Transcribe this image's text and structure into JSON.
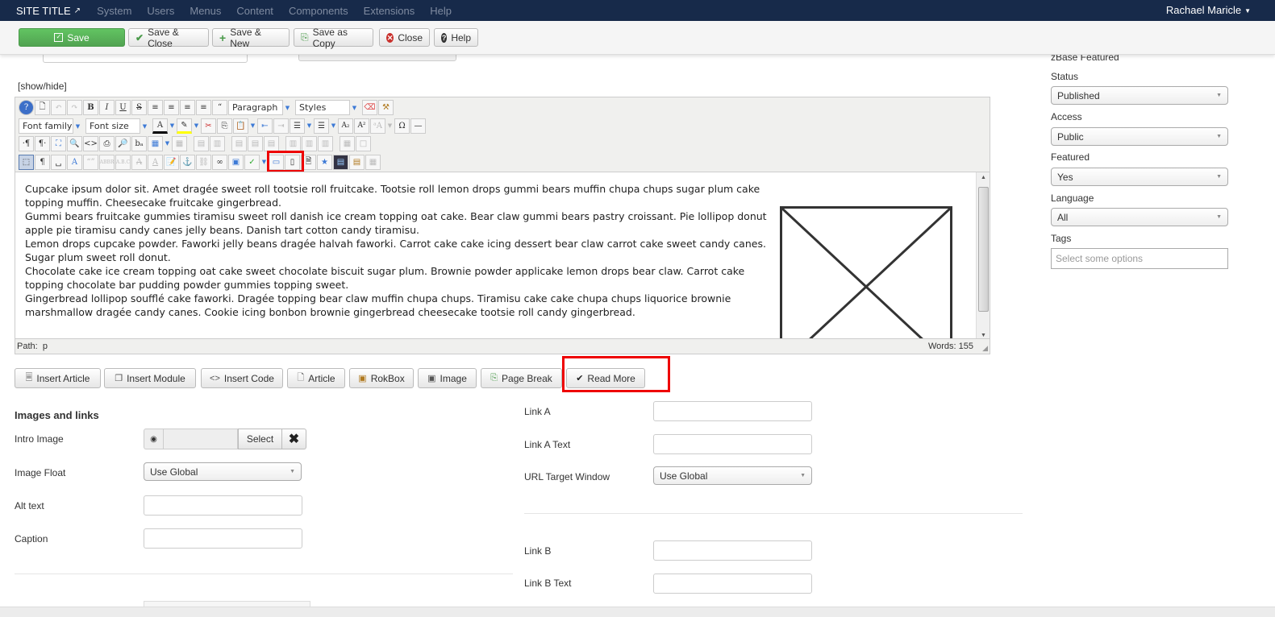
{
  "navbar": {
    "site_title": "SITE TITLE",
    "site_title_icon": "external-link-icon",
    "menu": [
      "System",
      "Users",
      "Menus",
      "Content",
      "Components",
      "Extensions",
      "Help"
    ],
    "user": "Rachael Maricle"
  },
  "toolbar": {
    "save": "Save",
    "save_close": "Save & Close",
    "save_new": "Save & New",
    "save_copy": "Save as Copy",
    "close": "Close",
    "help": "Help"
  },
  "editor": {
    "show_hide": "[show/hide]",
    "format_select": "Paragraph",
    "styles_select": "Styles",
    "font_family_select": "Font family",
    "font_size_select": "Font size",
    "paragraphs": [
      "Cupcake ipsum dolor sit. Amet dragée sweet roll tootsie roll fruitcake. Tootsie roll lemon drops gummi bears muffin chupa chups sugar plum cake topping muffin. Cheesecake fruitcake gingerbread.",
      "Gummi bears fruitcake gummies tiramisu sweet roll danish ice cream topping oat cake. Bear claw gummi bears pastry croissant. Pie lollipop donut apple pie tiramisu candy canes jelly beans. Danish tart cotton candy tiramisu.",
      "Lemon drops cupcake powder. Faworki jelly beans dragée halvah faworki. Carrot cake cake icing dessert bear claw carrot cake sweet candy canes. Sugar plum sweet roll donut.",
      "Chocolate cake ice cream topping oat cake sweet chocolate biscuit sugar plum. Brownie powder applicake lemon drops bear claw. Carrot cake topping chocolate bar pudding powder gummies topping sweet.",
      "Gingerbread lollipop soufflé cake faworki. Dragée topping bear claw muffin chupa chups. Tiramisu cake cake chupa chups liquorice brownie marshmallow dragée candy canes. Cookie icing bonbon brownie gingerbread cheesecake tootsie roll candy gingerbread."
    ],
    "path_label": "Path:",
    "path_value": "p",
    "word_count_label": "Words: 155"
  },
  "editor_buttons": [
    "Insert Article",
    "Insert Module",
    "Insert Code",
    "Article",
    "RokBox",
    "Image",
    "Page Break",
    "Read More"
  ],
  "images_links": {
    "title": "Images and links",
    "intro_image_label": "Intro Image",
    "select_button": "Select",
    "image_float_label": "Image Float",
    "image_float_value": "Use Global",
    "alt_text_label": "Alt text",
    "caption_label": "Caption",
    "link_a_label": "Link A",
    "link_a_text_label": "Link A Text",
    "url_target_label": "URL Target Window",
    "url_target_value": "Use Global",
    "link_b_label": "Link B",
    "link_b_text_label": "Link B Text"
  },
  "sidebar": {
    "category_heading": "zBase Featured",
    "status_label": "Status",
    "status_value": "Published",
    "access_label": "Access",
    "access_value": "Public",
    "featured_label": "Featured",
    "featured_value": "Yes",
    "language_label": "Language",
    "language_value": "All",
    "tags_label": "Tags",
    "tags_placeholder": "Select some options"
  }
}
